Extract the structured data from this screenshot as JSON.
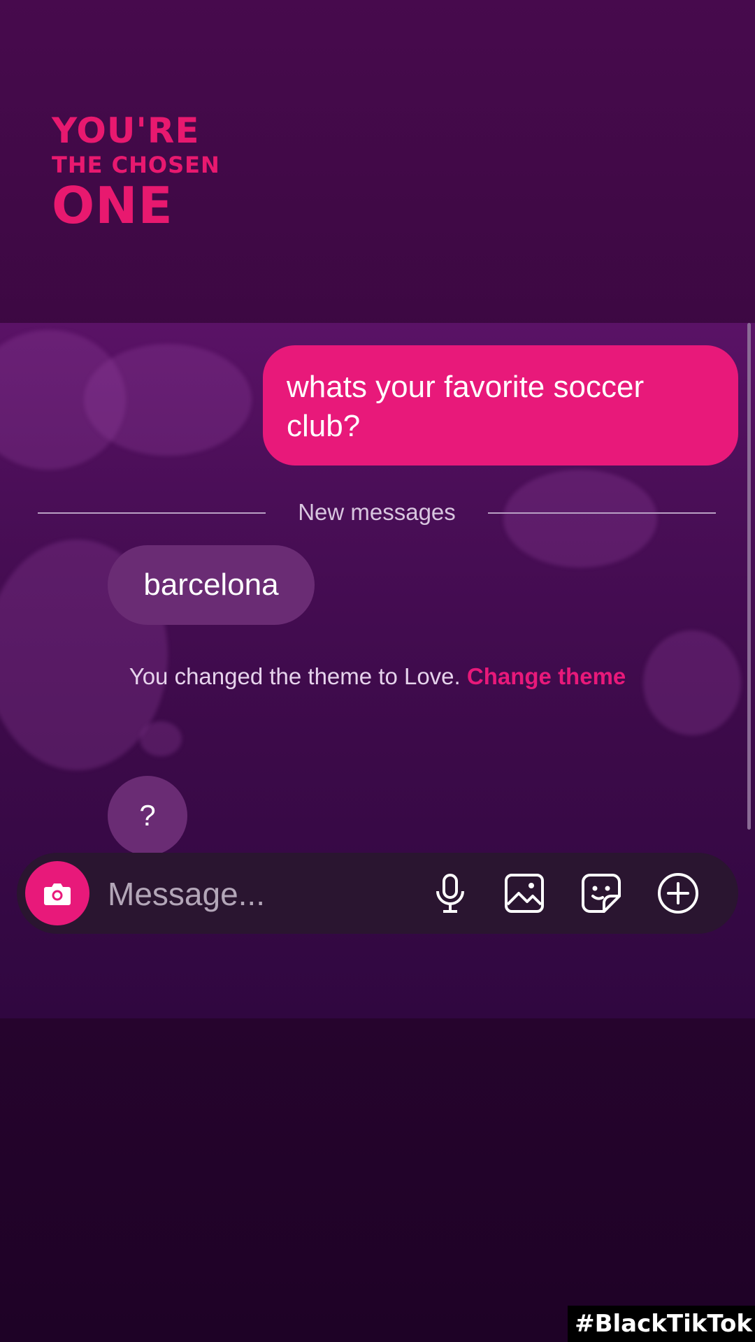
{
  "promo": {
    "line1": "YOU'RE",
    "line2": "THE CHOSEN",
    "line3": "ONE"
  },
  "conversation": {
    "outgoing_message": "whats your favorite soccer club?",
    "divider_label": "New messages",
    "incoming_message": "barcelona",
    "system_notice": "You changed the theme to Love.",
    "system_link": "Change theme",
    "incoming_reply": "?"
  },
  "composer": {
    "placeholder": "Message...",
    "icons": [
      "camera-icon",
      "microphone-icon",
      "gallery-icon",
      "sticker-icon",
      "plus-icon"
    ]
  },
  "watermark": "#BlackTikTok",
  "colors": {
    "accent": "#e8197a",
    "background": "#3a0840",
    "incoming_bubble": "#6a2c74"
  }
}
